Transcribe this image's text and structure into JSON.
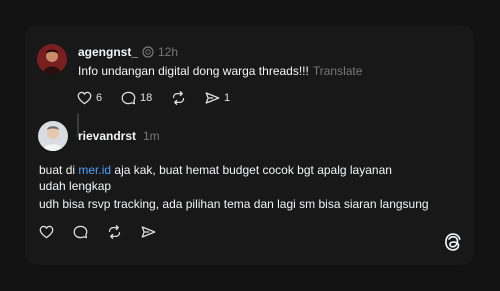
{
  "post": {
    "username": "agengnst_",
    "time": "12h",
    "text": "Info undangan digital dong warga threads!!!",
    "translate": "Translate",
    "likes": "6",
    "comments": "18",
    "shares": "1"
  },
  "reply": {
    "username": "rievandrst",
    "time": "1m",
    "text_prefix": "buat di ",
    "link": "mer.id",
    "text_line1_rest": " aja kak, buat hemat budget cocok bgt apalg layanan",
    "text_line2": "udah lengkap",
    "text_line3": "udh bisa rsvp tracking, ada pilihan tema dan lagi sm bisa siaran langsung"
  },
  "icons": {
    "verified": "verified-badge-icon",
    "like": "heart-icon",
    "comment": "comment-bubble-icon",
    "repost": "repost-icon",
    "share": "send-icon",
    "logo": "threads-logo-icon"
  },
  "colors": {
    "background": "#121212",
    "card": "#181818",
    "link": "#4a9fff",
    "muted": "#777777"
  }
}
